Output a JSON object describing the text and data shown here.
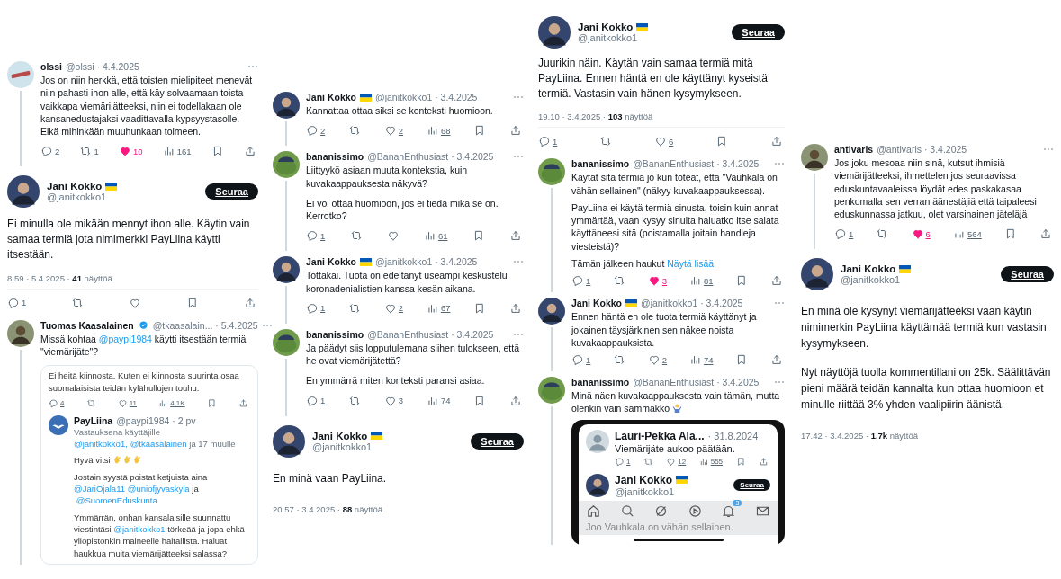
{
  "columns": [
    {
      "items": [
        {
          "kind": "reply",
          "avatar": {
            "kind": "logo"
          },
          "author": "olssi",
          "flag": false,
          "verified": false,
          "handle_line": "@olssi · 4.4.2025",
          "paragraphs": [
            "Jos on niin herkkä, että toisten mielipiteet menevät niin pahasti ihon alle, että käy solvaamaan toista vaikkapa viemärijätteeksi, niin ei todellakaan ole kansanedustajaksi vaadittavalla kypsyystasolle. Eikä mihinkään muuhunkaan toimeen."
          ],
          "stats": {
            "replies": "2",
            "retweets": "1",
            "likes": "10",
            "liked": true,
            "views": "161"
          }
        },
        {
          "kind": "main",
          "avatar": {
            "kind": "portrait"
          },
          "author": "Jani Kokko",
          "flag": true,
          "handle": "@janitkokko1",
          "follow": "Seuraa",
          "paragraphs": [
            "Ei minulla ole mikään mennyt ihon alle. Käytin vain samaa termiä jota nimimerkki PayLiina käytti itsestään."
          ],
          "meta": "8.59 · 5.4.2025 · **41** näyttöä",
          "stats": {
            "replies": "1",
            "liked": false
          }
        },
        {
          "kind": "reply",
          "avatar": {
            "kind": "photo"
          },
          "author": "Tuomas Kaasalainen",
          "flag": false,
          "verified": true,
          "handle_line": "@tkaasalain... · 5.4.2025",
          "paragraphs": [
            [
              {
                "kind": "text",
                "t": "Missä kohtaa "
              },
              {
                "kind": "mention",
                "t": "@paypi1984"
              },
              {
                "kind": "text",
                "t": " käytti itsestään termiä \"viemärijäte\"?"
              }
            ]
          ],
          "embed": {
            "kind": "thread",
            "lead_text": "Ei heitä kiinnosta. Kuten ei kiinnosta suurinta osaa suomalaisista teidän kylähullujen touhu.",
            "lead_stats": {
              "replies": "4",
              "likes": "11",
              "liked": false,
              "views": "4,1K"
            },
            "reply": {
              "avatar": {
                "kind": "bird"
              },
              "author": "PayLiina",
              "handle_line": "@paypi1984 · 2 pv",
              "context": [
                {
                  "kind": "text",
                  "t": "Vastauksena käyttäjille "
                },
                {
                  "kind": "mention",
                  "t": "@janitkokko1,"
                },
                {
                  "kind": "mention",
                  "t": "@tkaasalainen"
                },
                {
                  "kind": "text",
                  "t": " ja 17 muulle"
                }
              ],
              "paragraphs": [
                [
                  {
                    "kind": "text",
                    "t": "Hyvä vitsi "
                  },
                  {
                    "kind": "clap"
                  },
                  {
                    "kind": "clap"
                  },
                  {
                    "kind": "clap"
                  }
                ],
                [
                  {
                    "kind": "text",
                    "t": "Jostain syystä poistat ketjuista aina "
                  },
                  {
                    "kind": "mention",
                    "t": "@JariOjala11"
                  },
                  {
                    "kind": "mention",
                    "t": "@uniofjyvaskyla"
                  },
                  {
                    "kind": "text",
                    "t": " ja "
                  },
                  {
                    "kind": "mention",
                    "t": "@SuomenEduskunta"
                  }
                ],
                [
                  {
                    "kind": "text",
                    "t": "Ymmärrän, onhan kansalaisille suunnattu viestintäsi "
                  },
                  {
                    "kind": "mention",
                    "t": "@janitkokko1"
                  },
                  {
                    "kind": "text",
                    "t": " törkeää ja jopa ehkä yliopistonkin maineelle haitallista. Haluat haukkua muita viemärijätteeksi salassa?"
                  }
                ]
              ]
            }
          }
        }
      ]
    },
    {
      "items": [
        {
          "kind": "reply",
          "avatar": {
            "kind": "portrait"
          },
          "author": "Jani Kokko",
          "flag": true,
          "verified": false,
          "handle_line": "@janitkokko1 · 3.4.2025",
          "paragraphs": [
            "Kannattaa ottaa siksi se konteksti huomioon."
          ],
          "stats": {
            "replies": "2",
            "likes": "2",
            "liked": false,
            "views": "68"
          }
        },
        {
          "kind": "reply",
          "avatar": {
            "kind": "frog"
          },
          "author": "bananissimo",
          "flag": false,
          "verified": false,
          "handle_line": "@BananEnthusiast · 3.4.2025",
          "paragraphs": [
            "Liittyykö asiaan muuta kontekstia, kuin kuvakaappauksesta näkyvä?",
            "Ei voi ottaa huomioon, jos ei tiedä mikä se on. Kerrotko?"
          ],
          "stats": {
            "replies": "1",
            "liked": false,
            "views": "61"
          }
        },
        {
          "kind": "reply",
          "avatar": {
            "kind": "portrait"
          },
          "author": "Jani Kokko",
          "flag": true,
          "verified": false,
          "handle_line": "@janitkokko1 · 3.4.2025",
          "paragraphs": [
            "Tottakai. Tuota on edeltänyt useampi keskustelu koronadenialistien kanssa kesän aikana."
          ],
          "stats": {
            "replies": "1",
            "likes": "2",
            "liked": false,
            "views": "67"
          }
        },
        {
          "kind": "reply",
          "avatar": {
            "kind": "frog"
          },
          "author": "bananissimo",
          "flag": false,
          "verified": false,
          "handle_line": "@BananEnthusiast · 3.4.2025",
          "paragraphs": [
            "Ja päädyt siis lopputulemana siihen tulokseen, että he ovat viemärijätettä?",
            "En ymmärrä miten konteksti paransi asiaa."
          ],
          "stats": {
            "replies": "1",
            "likes": "3",
            "liked": false,
            "views": "74"
          }
        },
        {
          "kind": "main",
          "avatar": {
            "kind": "portrait"
          },
          "author": "Jani Kokko",
          "flag": true,
          "handle": "@janitkokko1",
          "follow": "Seuraa",
          "paragraphs": [
            "En minä vaan PayLiina."
          ],
          "meta": "20.57 · 3.4.2025 · **88** näyttöä"
        }
      ]
    },
    {
      "items": [
        {
          "kind": "main",
          "avatar": {
            "kind": "portrait"
          },
          "author": "Jani Kokko",
          "flag": true,
          "handle": "@janitkokko1",
          "follow": "Seuraa",
          "paragraphs": [
            "Juurikin näin. Käytän vain samaa termiä mitä PayLiina. Ennen häntä en ole käyttänyt kyseistä termiä. Vastasin vain hänen kysymykseen."
          ],
          "meta": "19.10 · 3.4.2025 · **103** näyttöä",
          "stats": {
            "replies": "1",
            "likes": "6",
            "liked": false
          }
        },
        {
          "kind": "reply",
          "avatar": {
            "kind": "frog"
          },
          "author": "bananissimo",
          "flag": false,
          "verified": false,
          "handle_line": "@BananEnthusiast · 3.4.2025",
          "paragraphs": [
            "Käytät sitä termiä jo kun toteat, että \"Vauhkala on vähän sellainen\" (näkyy kuvakaappauksessa).",
            "PayLiina ei käytä termiä sinusta, toisin kuin annat ymmärtää, vaan kysyy sinulta haluatko itse salata käyttäneesi sitä (poistamalla joitain handleja viesteistä)?",
            [
              {
                "kind": "text",
                "t": "Tämän jälkeen haukut "
              },
              {
                "kind": "more",
                "t": "Näytä lisää"
              }
            ]
          ],
          "stats": {
            "replies": "1",
            "likes": "3",
            "liked": true,
            "views": "81"
          }
        },
        {
          "kind": "reply",
          "avatar": {
            "kind": "portrait"
          },
          "author": "Jani Kokko",
          "flag": true,
          "verified": false,
          "handle_line": "@janitkokko1 · 3.4.2025",
          "paragraphs": [
            "Ennen häntä en ole tuota termiä käyttänyt ja jokainen täysjärkinen sen näkee noista kuvakaappauksista."
          ],
          "stats": {
            "replies": "1",
            "likes": "2",
            "liked": false,
            "views": "74"
          }
        },
        {
          "kind": "reply",
          "avatar": {
            "kind": "frog"
          },
          "author": "bananissimo",
          "flag": false,
          "verified": false,
          "handle_line": "@BananEnthusiast · 3.4.2025",
          "paragraphs": [
            [
              {
                "kind": "text",
                "t": "Minä näen kuvakaappauksesta vain tämän, mutta olenkin vain sammakko "
              },
              {
                "kind": "shrug"
              }
            ]
          ],
          "embed": {
            "kind": "phone",
            "post": {
              "avatar": {
                "kind": "blank"
              },
              "author": "Lauri-Pekka Ala...",
              "handle_line": "· 31.8.2024",
              "text": "Viemärijäte aukoo päätään.",
              "stats": {
                "replies": "1",
                "likes": "12",
                "liked": false,
                "views": "555"
              }
            },
            "profile": {
              "avatar": {
                "kind": "portrait"
              },
              "author": "Jani Kokko",
              "flag": true,
              "handle": "@janitkokko1",
              "follow": "Seuraa"
            },
            "nav": {
              "badge": "3"
            },
            "text": "Joo Vauhkala on vähän sellainen."
          }
        }
      ]
    },
    {
      "items": [
        {
          "kind": "reply",
          "avatar": {
            "kind": "photo"
          },
          "author": "antivaris",
          "flag": false,
          "verified": false,
          "handle_line": "@antivaris · 3.4.2025",
          "paragraphs": [
            "Jos joku mesoaa niin sinä, kutsut ihmisiä viemärijätteeksi, ihmettelen jos seuraavissa eduskuntavaaleissa löydät edes paskakasaa penkomalla sen verran äänestäjiä että taipaleesi eduskunnassa jatkuu, olet varsinainen jäteläjä"
          ],
          "stats": {
            "replies": "1",
            "likes": "6",
            "liked": true,
            "views": "564"
          }
        },
        {
          "kind": "main",
          "avatar": {
            "kind": "portrait"
          },
          "author": "Jani Kokko",
          "flag": true,
          "handle": "@janitkokko1",
          "follow": "Seuraa",
          "paragraphs": [
            "En minä ole kysynyt viemärijätteeksi vaan käytin nimimerkin PayLiina käyttämää termiä kun vastasin kysymykseen.",
            "Nyt näyttöjä tuolla kommentillani on 25k. Säälittävän pieni määrä teidän kannalta kun ottaa huomioon et minulle riittää 3% yhden vaalipiirin äänistä."
          ],
          "meta": "17.42 · 3.4.2025 · **1,7k** näyttöä"
        }
      ]
    }
  ]
}
